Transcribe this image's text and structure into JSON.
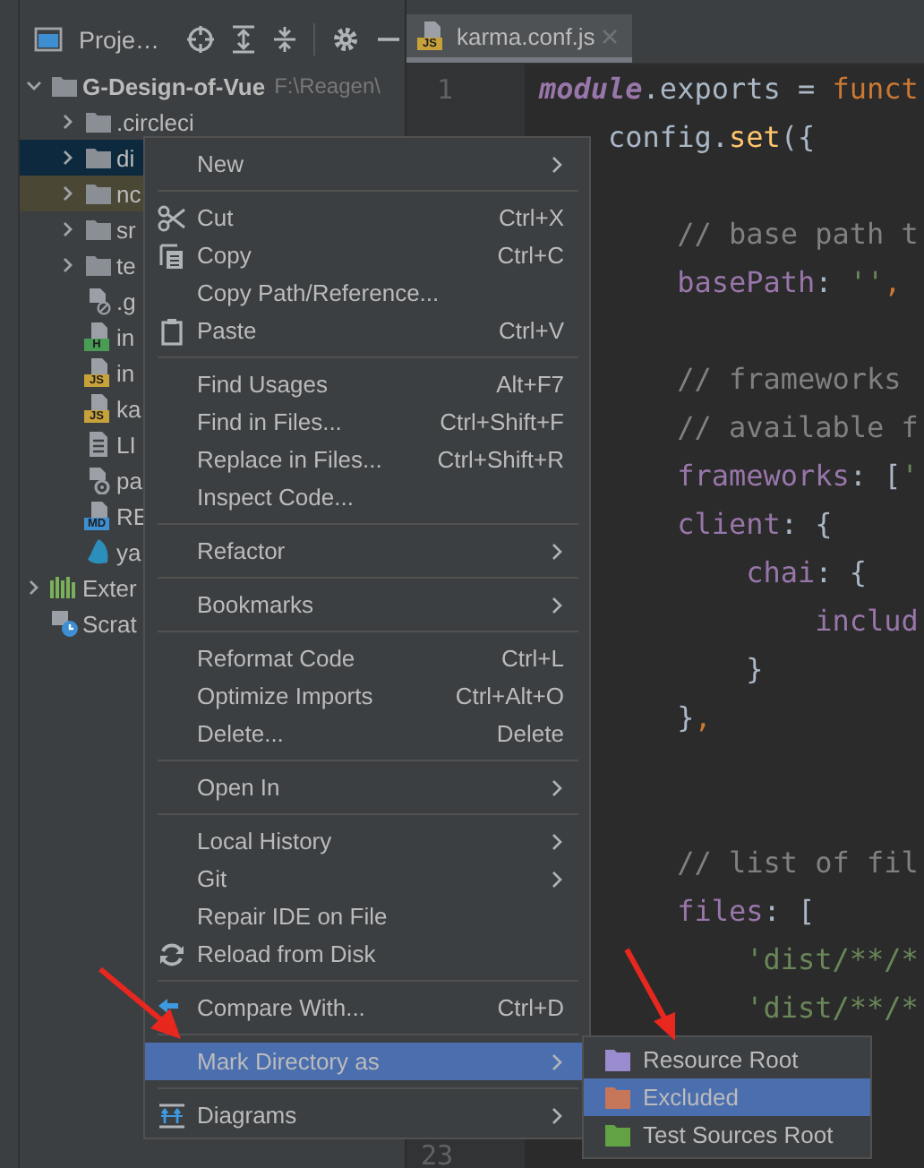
{
  "project_panel": {
    "title": "Proje…"
  },
  "tree": [
    {
      "label": "G-Design-of-Vue",
      "path": "F:\\Reagen\\",
      "kind": "folder",
      "expanded": true,
      "selected": false,
      "excluded": false,
      "children": [
        {
          "label": ".circleci",
          "kind": "folder",
          "expanded": false,
          "selected": false,
          "excluded": false
        },
        {
          "label": "di",
          "kind": "folder",
          "expanded": false,
          "selected": true,
          "excluded": false
        },
        {
          "label": "nc",
          "kind": "folder",
          "expanded": false,
          "selected": false,
          "excluded": true
        },
        {
          "label": "sr",
          "kind": "folder",
          "expanded": false,
          "selected": false,
          "excluded": false
        },
        {
          "label": "te",
          "kind": "folder",
          "expanded": false,
          "selected": false,
          "excluded": false
        },
        {
          "label": ".g",
          "kind": "ignore",
          "selected": false,
          "excluded": false
        },
        {
          "label": "in",
          "kind": "html",
          "badge": "H",
          "selected": false,
          "excluded": false
        },
        {
          "label": "in",
          "kind": "js",
          "badge": "JS",
          "selected": false,
          "excluded": false
        },
        {
          "label": "ka",
          "kind": "js",
          "badge": "JS",
          "selected": false,
          "excluded": false
        },
        {
          "label": "LI",
          "kind": "text",
          "selected": false,
          "excluded": false
        },
        {
          "label": "pa",
          "kind": "config",
          "selected": false,
          "excluded": false
        },
        {
          "label": "RE",
          "kind": "md",
          "badge": "MD",
          "selected": false,
          "excluded": false
        },
        {
          "label": "ya",
          "kind": "yarn",
          "selected": false,
          "excluded": false
        }
      ]
    },
    {
      "label": "Exter",
      "kind": "libraries",
      "expanded": false,
      "selected": false,
      "excluded": false
    },
    {
      "label": "Scrat",
      "kind": "scratches",
      "selected": false,
      "excluded": false
    }
  ],
  "editor_tab": {
    "label": "karma.conf.js",
    "badge": "JS",
    "selected": true
  },
  "line_numbers": {
    "first": "1",
    "last": "23"
  },
  "code_blocks": [
    {
      "lines": [
        [
          {
            "kind": "global",
            "text": "module"
          },
          {
            "kind": "plain",
            "text": ".exports = "
          },
          {
            "kind": "keyword",
            "text": "funct"
          }
        ],
        [
          {
            "kind": "plain",
            "text": "    config."
          },
          {
            "kind": "method",
            "text": "set"
          },
          {
            "kind": "plain",
            "text": "({"
          }
        ]
      ]
    },
    {
      "lines": [
        [
          {
            "kind": "comment",
            "text": "        // base path t"
          }
        ],
        [
          {
            "kind": "field",
            "text": "        basePath"
          },
          {
            "kind": "plain",
            "text": ": "
          },
          {
            "kind": "string",
            "text": "''"
          },
          {
            "kind": "keyword",
            "text": ","
          }
        ]
      ]
    },
    {
      "lines": [
        [
          {
            "kind": "comment",
            "text": "        // frameworks"
          }
        ],
        [
          {
            "kind": "comment",
            "text": "        // available f"
          }
        ],
        [
          {
            "kind": "field",
            "text": "        frameworks"
          },
          {
            "kind": "plain",
            "text": ": ["
          },
          {
            "kind": "string",
            "text": "'"
          }
        ],
        [
          {
            "kind": "field",
            "text": "        client"
          },
          {
            "kind": "plain",
            "text": ": {"
          }
        ],
        [
          {
            "kind": "field",
            "text": "            chai"
          },
          {
            "kind": "plain",
            "text": ": {"
          }
        ],
        [
          {
            "kind": "field",
            "text": "                includ"
          }
        ],
        [
          {
            "kind": "plain",
            "text": "            }"
          }
        ],
        [
          {
            "kind": "plain",
            "text": "        }"
          },
          {
            "kind": "keyword",
            "text": ","
          }
        ]
      ]
    },
    {
      "lines": [
        [
          {
            "kind": "comment",
            "text": "        // list of fil"
          }
        ],
        [
          {
            "kind": "field",
            "text": "        files"
          },
          {
            "kind": "plain",
            "text": ": ["
          }
        ],
        [
          {
            "kind": "string",
            "text": "            'dist/**/*"
          }
        ],
        [
          {
            "kind": "string",
            "text": "            'dist/**/*"
          }
        ]
      ]
    }
  ],
  "context_menu": [
    [
      {
        "label": "New",
        "submenu": true,
        "selected": false
      }
    ],
    [
      {
        "label": "Cut",
        "shortcut": "Ctrl+X",
        "submenu": false,
        "selected": false
      },
      {
        "label": "Copy",
        "shortcut": "Ctrl+C",
        "submenu": false,
        "selected": false
      },
      {
        "label": "Copy Path/Reference...",
        "submenu": false,
        "selected": false
      },
      {
        "label": "Paste",
        "shortcut": "Ctrl+V",
        "submenu": false,
        "selected": false
      }
    ],
    [
      {
        "label": "Find Usages",
        "shortcut": "Alt+F7",
        "submenu": false,
        "selected": false
      },
      {
        "label": "Find in Files...",
        "shortcut": "Ctrl+Shift+F",
        "submenu": false,
        "selected": false
      },
      {
        "label": "Replace in Files...",
        "shortcut": "Ctrl+Shift+R",
        "submenu": false,
        "selected": false
      },
      {
        "label": "Inspect Code...",
        "submenu": false,
        "selected": false
      }
    ],
    [
      {
        "label": "Refactor",
        "submenu": true,
        "selected": false
      }
    ],
    [
      {
        "label": "Bookmarks",
        "submenu": true,
        "selected": false
      }
    ],
    [
      {
        "label": "Reformat Code",
        "shortcut": "Ctrl+L",
        "submenu": false,
        "selected": false
      },
      {
        "label": "Optimize Imports",
        "shortcut": "Ctrl+Alt+O",
        "submenu": false,
        "selected": false
      },
      {
        "label": "Delete...",
        "shortcut": "Delete",
        "submenu": false,
        "selected": false
      }
    ],
    [
      {
        "label": "Open In",
        "submenu": true,
        "selected": false
      }
    ],
    [
      {
        "label": "Local History",
        "submenu": true,
        "selected": false
      },
      {
        "label": "Git",
        "submenu": true,
        "selected": false
      },
      {
        "label": "Repair IDE on File",
        "submenu": false,
        "selected": false
      },
      {
        "label": "Reload from Disk",
        "submenu": false,
        "selected": false
      }
    ],
    [
      {
        "label": "Compare With...",
        "shortcut": "Ctrl+D",
        "submenu": false,
        "selected": false
      }
    ],
    [
      {
        "label": "Mark Directory as",
        "submenu": true,
        "selected": true
      }
    ],
    [
      {
        "label": "Diagrams",
        "submenu": true,
        "selected": false
      }
    ]
  ],
  "submenu": [
    {
      "label": "Resource Root",
      "color": "#9a8ccf",
      "selected": false
    },
    {
      "label": "Excluded",
      "color": "#c6775a",
      "selected": true
    },
    {
      "label": "Test Sources Root",
      "color": "#62a245",
      "selected": false
    }
  ]
}
